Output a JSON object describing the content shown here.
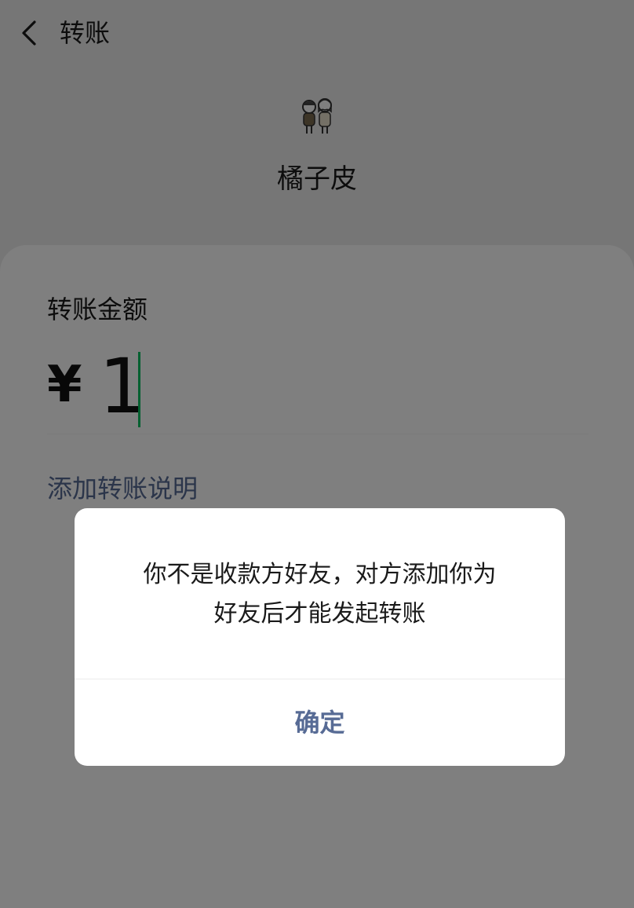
{
  "nav": {
    "back_icon": "chevron-left-icon",
    "title": "转账"
  },
  "payee": {
    "avatar_icon": "cartoon-couple-avatar",
    "name": "橘子皮"
  },
  "transfer": {
    "amount_label": "转账金额",
    "currency": "¥",
    "amount": "1",
    "add_note": "添加转账说明"
  },
  "dialog": {
    "message_line1": "你不是收款方好友，对方添加你为",
    "message_line2": "好友后才能发起转账",
    "confirm_label": "确定"
  },
  "colors": {
    "accent_green": "#07c160",
    "link_blue": "#576b95",
    "background": "#ededed"
  }
}
